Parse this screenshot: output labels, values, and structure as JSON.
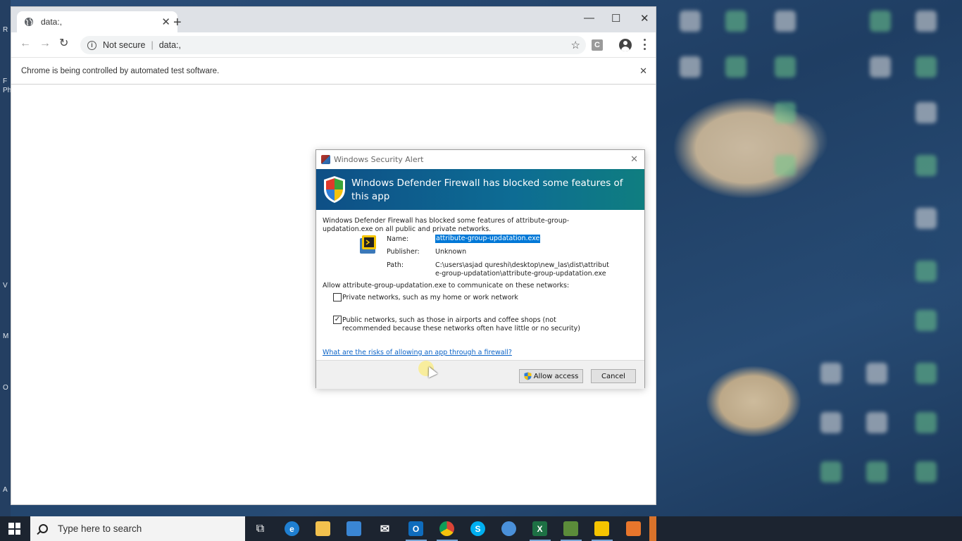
{
  "desktop": {
    "left_strip_letters": [
      "R",
      "F",
      "Ph",
      "V",
      "M",
      "O",
      "A"
    ]
  },
  "browser": {
    "tab_title": "data:,",
    "tab_close": "✕",
    "new_tab": "+",
    "window_controls": {
      "minimize": "—",
      "maximize": "☐",
      "close": "✕"
    },
    "nav": {
      "back": "←",
      "forward": "→",
      "reload": "↻"
    },
    "security_label": "Not secure",
    "url": "data:,",
    "bookmark_star": "☆",
    "extension_letter": "C",
    "infobar_message": "Chrome is being controlled by automated test software.",
    "infobar_close": "✕"
  },
  "dialog": {
    "window_title": "Windows Security Alert",
    "close": "✕",
    "headline": "Windows Defender Firewall has blocked some features of this app",
    "description": "Windows Defender Firewall has blocked some features of attribute-group-updatation.exe on all public and private networks.",
    "fields": {
      "name_label": "Name:",
      "name_value": "attribute-group-updatation.exe",
      "publisher_label": "Publisher:",
      "publisher_value": "Unknown",
      "path_label": "Path:",
      "path_value": "C:\\users\\asjad qureshi\\desktop\\new_las\\dist\\attribute-group-updatation\\attribute-group-updatation.exe"
    },
    "allow_prompt": "Allow attribute-group-updatation.exe to communicate on these networks:",
    "networks": [
      {
        "label": "Private networks, such as my home or work network",
        "checked": false
      },
      {
        "label": "Public networks, such as those in airports and coffee shops (not recommended because these networks often have little or no security)",
        "checked": true
      }
    ],
    "checkmark": "✓",
    "risk_link": "What are the risks of allowing an app through a firewall?",
    "allow_button": "Allow access",
    "cancel_button": "Cancel"
  },
  "taskbar": {
    "search_placeholder": "Type here to search",
    "apps": [
      {
        "name": "task-view",
        "glyph": "⧉",
        "color": "#1c2430"
      },
      {
        "name": "edge",
        "glyph": "e",
        "color": "#1f7fd1"
      },
      {
        "name": "file-explorer",
        "glyph": "",
        "color": "#f2c14e"
      },
      {
        "name": "store",
        "glyph": "",
        "color": "#3a86d4"
      },
      {
        "name": "mail",
        "glyph": "✉",
        "color": "#1c2430"
      },
      {
        "name": "outlook",
        "glyph": "O",
        "color": "#0f6cbd"
      },
      {
        "name": "chrome",
        "glyph": "",
        "color": "#db4437"
      },
      {
        "name": "skype",
        "glyph": "S",
        "color": "#00aff0"
      },
      {
        "name": "network-app",
        "glyph": "",
        "color": "#4a90d9"
      },
      {
        "name": "excel",
        "glyph": "X",
        "color": "#1d7044"
      },
      {
        "name": "spreadsheet-app",
        "glyph": "",
        "color": "#5b8c3a"
      },
      {
        "name": "python-app",
        "glyph": "",
        "color": "#f5c400"
      },
      {
        "name": "orange-app",
        "glyph": "",
        "color": "#e8762c"
      }
    ]
  }
}
